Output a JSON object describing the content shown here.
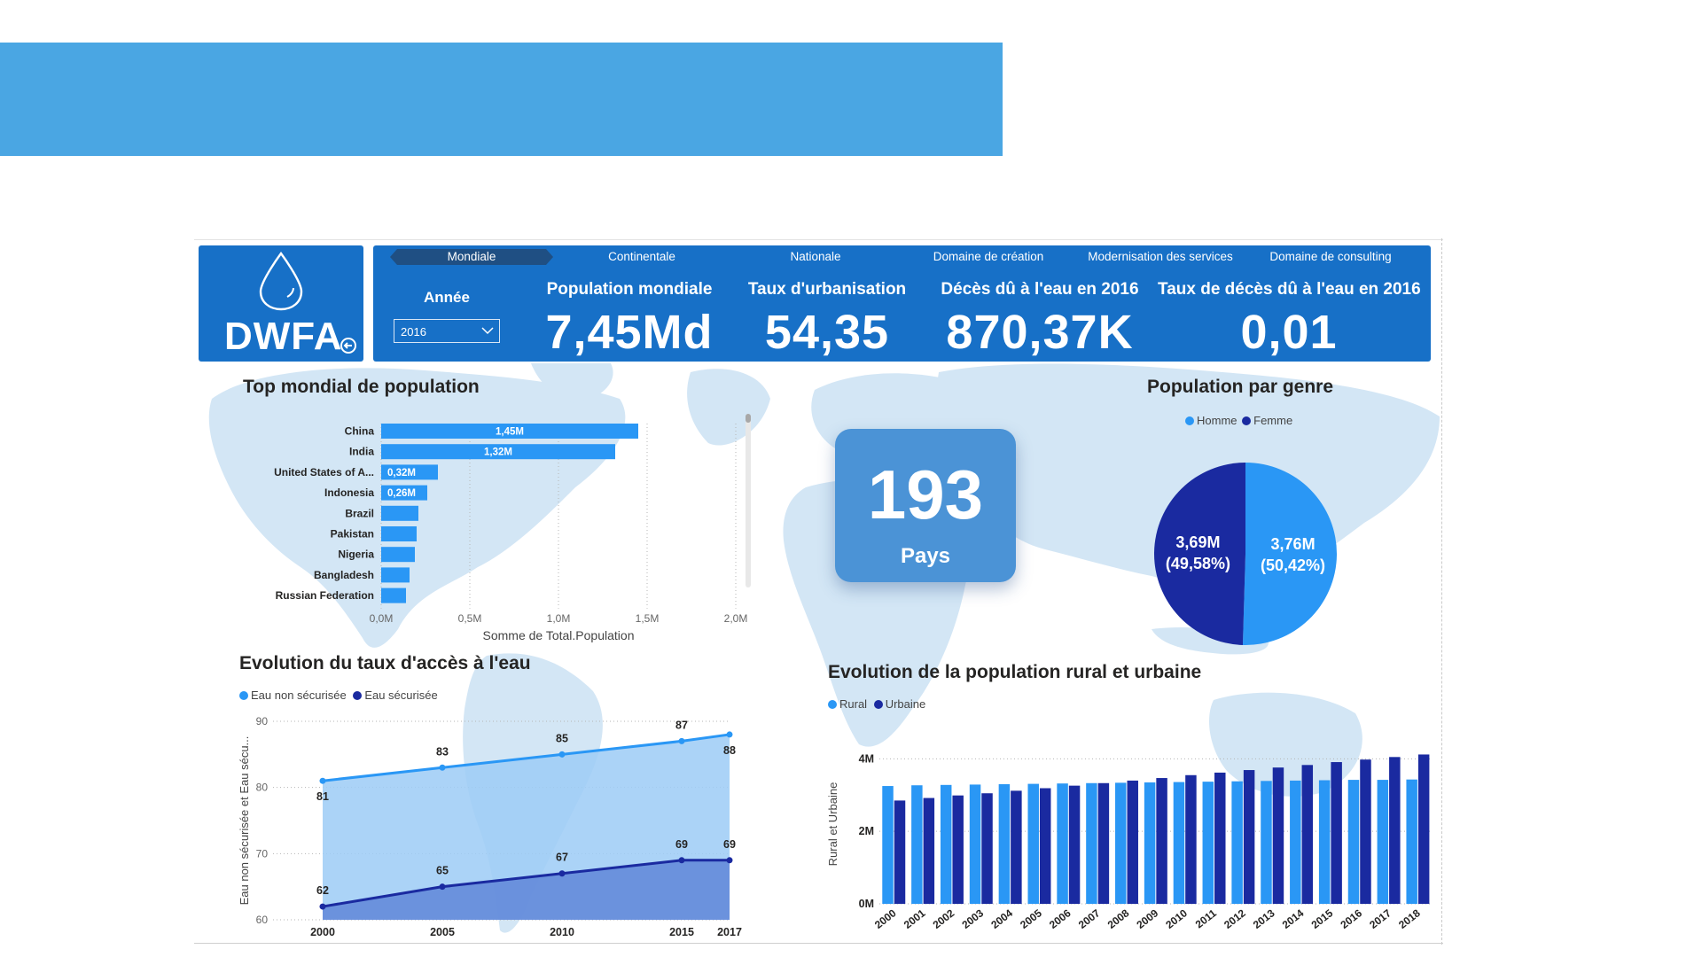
{
  "nav": {
    "tabs": [
      {
        "label": "Mondiale",
        "active": true
      },
      {
        "label": "Continentale",
        "active": false
      },
      {
        "label": "Nationale",
        "active": false
      },
      {
        "label": "Domaine de création",
        "active": false
      },
      {
        "label": "Modernisation des services",
        "active": false
      },
      {
        "label": "Domaine de consulting",
        "active": false
      }
    ]
  },
  "logo": {
    "text": "DWFA",
    "icon": "water-drop-icon"
  },
  "filter": {
    "label": "Année",
    "selected": "2016"
  },
  "kpis": [
    {
      "title": "Population mondiale",
      "value": "7,45Md"
    },
    {
      "title": "Taux d'urbanisation",
      "value": "54,35"
    },
    {
      "title": "Décès dû à l'eau en 2016",
      "value": "870,37K"
    },
    {
      "title": "Taux de décès dû à l'eau en 2016",
      "value": "0,01"
    }
  ],
  "pays_card": {
    "number": "193",
    "label": "Pays"
  },
  "colors": {
    "header": "#1770c7",
    "light_blue": "#2a97f5",
    "dark_blue": "#1a2aa0",
    "map": "#cfe3f4"
  },
  "chart_data": [
    {
      "type": "bar",
      "orientation": "horizontal",
      "title": "Top mondial de population",
      "xlabel": "Somme de Total.Population",
      "categories": [
        "China",
        "India",
        "United States of A...",
        "Indonesia",
        "Brazil",
        "Pakistan",
        "Nigeria",
        "Bangladesh",
        "Russian Federation"
      ],
      "values": [
        1.45,
        1.32,
        0.32,
        0.26,
        0.21,
        0.2,
        0.19,
        0.16,
        0.14
      ],
      "data_labels": [
        "1,45M",
        "1,32M",
        "0,32M",
        "0,26M",
        "",
        "",
        "",
        "",
        ""
      ],
      "xlim": [
        0,
        2.0
      ],
      "ticks": [
        "0,0M",
        "0,5M",
        "1,0M",
        "1,5M",
        "2,0M"
      ],
      "grid": true
    },
    {
      "type": "pie",
      "title": "Population par genre",
      "legend": [
        "Homme",
        "Femme"
      ],
      "slices": [
        {
          "name": "Homme",
          "value": 3.76,
          "label": "3,76M",
          "pct": "(50,42%)"
        },
        {
          "name": "Femme",
          "value": 3.69,
          "label": "3,69M",
          "pct": "(49,58%)"
        }
      ]
    },
    {
      "type": "area",
      "title": "Evolution du taux d'accès à l'eau",
      "ylabel": "Eau non sécurisée et Eau sécu...",
      "legend": [
        "Eau non sécurisée",
        "Eau sécurisée"
      ],
      "x": [
        "2000",
        "2005",
        "2010",
        "2015",
        "2017"
      ],
      "ylim": [
        60,
        90
      ],
      "yticks": [
        60,
        70,
        80,
        90
      ],
      "series": [
        {
          "name": "Eau non sécurisée",
          "values": [
            81,
            83,
            85,
            87,
            88
          ]
        },
        {
          "name": "Eau sécurisée",
          "values": [
            62,
            65,
            67,
            69,
            69
          ]
        }
      ],
      "grid": true
    },
    {
      "type": "bar",
      "title": "Evolution de la population rural et urbaine",
      "ylabel": "Rural et Urbaine",
      "legend": [
        "Rural",
        "Urbaine"
      ],
      "categories": [
        "2000",
        "2001",
        "2002",
        "2003",
        "2004",
        "2005",
        "2006",
        "2007",
        "2008",
        "2009",
        "2010",
        "2011",
        "2012",
        "2013",
        "2014",
        "2015",
        "2016",
        "2017",
        "2018"
      ],
      "ylim": [
        0,
        4.4
      ],
      "yticks": [
        "0M",
        "2M",
        "4M"
      ],
      "yticks_values": [
        0,
        2,
        4
      ],
      "series": [
        {
          "name": "Rural",
          "values": [
            3.25,
            3.27,
            3.28,
            3.29,
            3.3,
            3.31,
            3.32,
            3.33,
            3.34,
            3.35,
            3.36,
            3.37,
            3.38,
            3.39,
            3.4,
            3.41,
            3.42,
            3.42,
            3.43
          ]
        },
        {
          "name": "Urbaine",
          "values": [
            2.85,
            2.92,
            2.99,
            3.05,
            3.12,
            3.19,
            3.26,
            3.33,
            3.4,
            3.47,
            3.55,
            3.62,
            3.69,
            3.76,
            3.83,
            3.91,
            3.98,
            4.05,
            4.12
          ]
        }
      ],
      "grid": true
    }
  ]
}
